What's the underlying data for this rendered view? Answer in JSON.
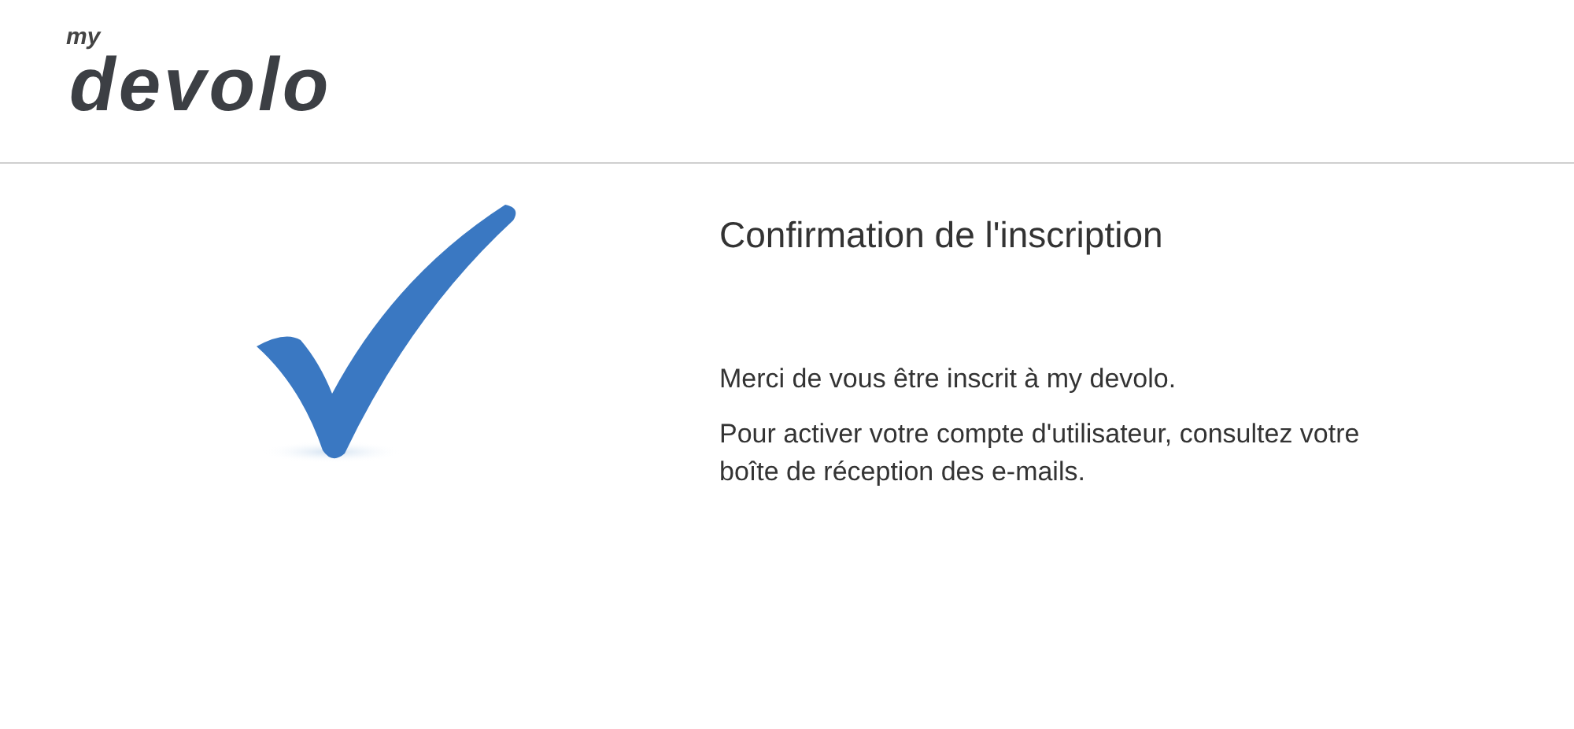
{
  "logo": {
    "prefix": "my",
    "name": "devolo"
  },
  "confirmation": {
    "title": "Confirmation de l'inscription",
    "paragraphs": [
      "Merci de vous être inscrit à my devolo.",
      "Pour activer votre compte d'utilisateur, consultez votre boîte de réception des e-mails."
    ]
  }
}
